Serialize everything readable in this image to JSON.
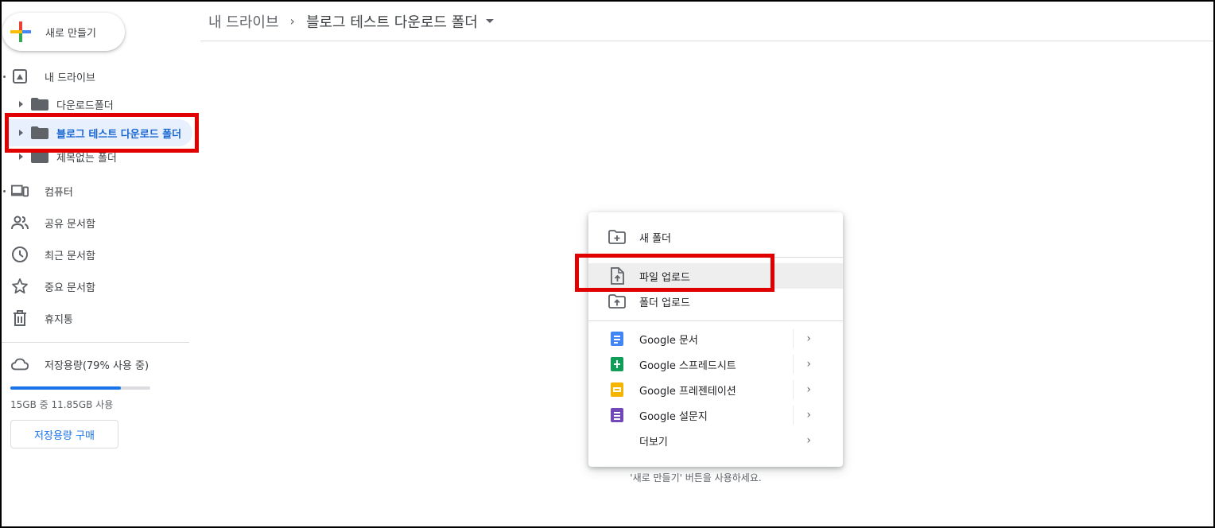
{
  "sidebar": {
    "new_button_label": "새로 만들기",
    "my_drive": "내 드라이브",
    "tree": [
      {
        "label": "다운로드폴더"
      },
      {
        "label": "블로그 테스트 다운로드 폴더",
        "selected": true
      },
      {
        "label": "제목없는 폴더"
      }
    ],
    "nav": [
      {
        "label": "컴퓨터",
        "icon": "computer-icon"
      },
      {
        "label": "공유 문서함",
        "icon": "people-icon"
      },
      {
        "label": "최근 문서함",
        "icon": "clock-icon"
      },
      {
        "label": "중요 문서함",
        "icon": "star-icon"
      },
      {
        "label": "휴지통",
        "icon": "trash-icon"
      }
    ],
    "storage": {
      "label": "저장용량(79% 사용 중)",
      "used_fraction": 0.79,
      "detail": "15GB 중 11.85GB 사용",
      "buy_label": "저장용량 구매"
    }
  },
  "header": {
    "breadcrumb_root": "내 드라이브",
    "breadcrumb_separator": "›",
    "breadcrumb_current": "블로그 테스트 다운로드 폴더"
  },
  "main": {
    "empty_hint": "'새로 만들기' 버튼을 사용하세요."
  },
  "menu": {
    "items": [
      {
        "label": "새 폴더",
        "icon": "new-folder-icon"
      },
      {
        "label": "파일 업로드",
        "icon": "file-upload-icon",
        "hovered": true
      },
      {
        "label": "폴더 업로드",
        "icon": "folder-upload-icon"
      },
      {
        "label": "Google 문서",
        "icon": "google-docs-icon",
        "color": "#4285f4",
        "submenu": true
      },
      {
        "label": "Google 스프레드시트",
        "icon": "google-sheets-icon",
        "color": "#0f9d58",
        "submenu": true
      },
      {
        "label": "Google 프레젠테이션",
        "icon": "google-slides-icon",
        "color": "#f4b400",
        "submenu": true
      },
      {
        "label": "Google 설문지",
        "icon": "google-forms-icon",
        "color": "#7248b9",
        "submenu": true
      },
      {
        "label": "더보기",
        "submenu": true
      }
    ],
    "chevron": "›"
  },
  "colors": {
    "accent": "#1a73e8",
    "highlight_box": "#e00000",
    "selected_bg": "#e8f0fe"
  }
}
